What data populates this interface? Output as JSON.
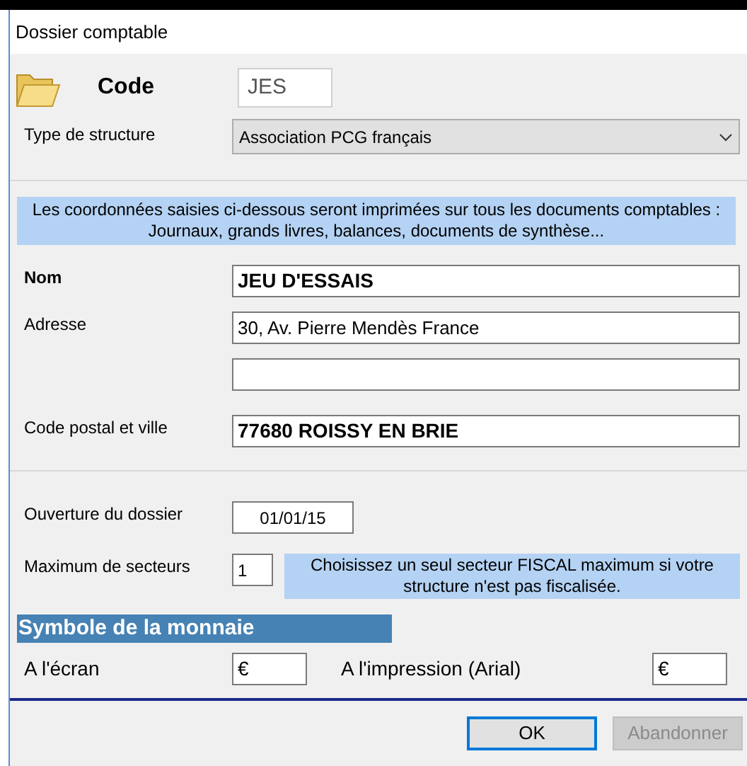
{
  "window": {
    "title": "Dossier comptable"
  },
  "code": {
    "label": "Code",
    "value": "JES"
  },
  "structure": {
    "label": "Type de structure",
    "value": "Association PCG français"
  },
  "info": "Les coordonnées saisies ci-dessous seront imprimées sur tous les documents comptables : Journaux, grands livres, balances, documents de synthèse...",
  "address_fields": [
    {
      "kind": "labelled",
      "label": "Nom",
      "value": "JEU D'ESSAIS",
      "bold": true
    },
    {
      "kind": "labelled",
      "label": "Adresse",
      "value": "30, Av. Pierre Mendès France",
      "bold": false
    },
    {
      "kind": "continuation"
    },
    {
      "kind": "labelled",
      "label": "Code postal et ville",
      "value": "77680 ROISSY EN BRIE",
      "bold": true
    }
  ],
  "opening": {
    "label": "Ouverture du dossier",
    "value": "01/01/15"
  },
  "sectors": {
    "label": "Maximum de secteurs",
    "value": "1",
    "hint": "Choisissez un seul secteur FISCAL maximum si votre structure n'est pas fiscalisée."
  },
  "currency": {
    "heading": "Symbole de la monnaie",
    "screen_label": "A l'écran",
    "screen_value": "€",
    "print_label": "A l'impression (Arial)",
    "print_value": "€"
  },
  "buttons": [
    {
      "label": "OK",
      "disabled": false,
      "default": true
    },
    {
      "label": "Abandonner",
      "disabled": true,
      "default": false
    }
  ]
}
